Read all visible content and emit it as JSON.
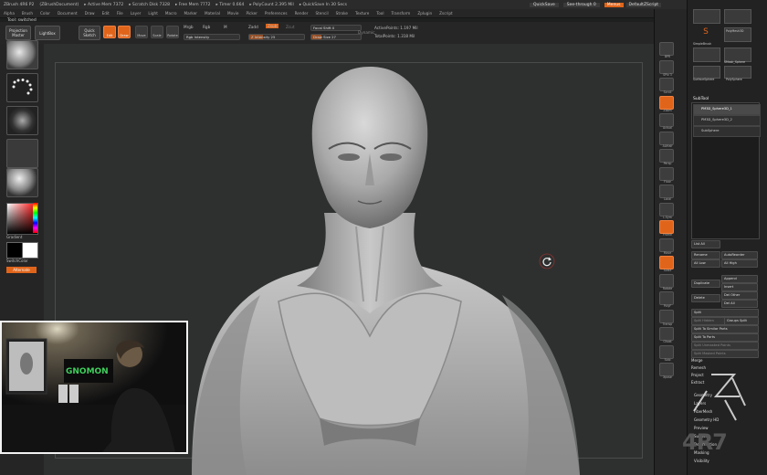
{
  "titlebar": {
    "items": [
      "ZBrush 4R6 P2",
      "(ZBrushDocument)",
      "▸ Active Mem 7372",
      "▸ Scratch Disk 7328",
      "▸ Free Mem 7772",
      "▸ Timer 0.664",
      "▸ PolyCount 2.395 Mil",
      "▸ QuickSave In 30 Secs"
    ],
    "quicksave": "QuickSave",
    "seethrough": "See-through",
    "seethrough_value": "0",
    "menus_btn": "Menus",
    "script": "DefaultZScript"
  },
  "menubar": [
    "Alpha",
    "Brush",
    "Color",
    "Document",
    "Draw",
    "Edit",
    "File",
    "Layer",
    "Light",
    "Macro",
    "Marker",
    "Material",
    "Movie",
    "Picker",
    "Preferences",
    "Render",
    "Stencil",
    "Stroke",
    "Texture",
    "Tool",
    "Transform",
    "Zplugin",
    "Zscript"
  ],
  "tool_title": "Tool: switched",
  "top_shelf": {
    "projection_master": "Projection Master",
    "lightbox": "LightBox",
    "quick_sketch": "Quick Sketch",
    "edit": "Edit",
    "draw": "Draw",
    "move": "Move",
    "scale": "Scale",
    "rotate": "Rotate",
    "mrgb": "Mrgb",
    "rgb": "Rgb",
    "m": "M",
    "rgb_intensity": "Rgb Intensity",
    "zadd": "Zadd",
    "zsub": "Zsub",
    "zcut": "Zcut",
    "z_intensity": "Z Intensity 25",
    "focal_shift": "Focal Shift 0",
    "draw_size": "Draw Size 27",
    "dynamic": "Dynamic",
    "active_points": "ActivePoints: 1.197 Mil",
    "total_points": "TotalPoints: 1.318 Mil"
  },
  "left_shelf": {
    "gradient": "Gradient",
    "switch_color": "SwitchColor",
    "alternate": "Alternate"
  },
  "right_shelf": {
    "labels": [
      "BPR",
      "SPix 3",
      "Scroll",
      "Zoom",
      "Actual",
      "AAHalf",
      "Persp",
      "Floor",
      "Local",
      "L.Sym",
      "Frame",
      "Move",
      "Scale",
      "Rotate",
      "PolyF",
      "Transp",
      "Ghost",
      "Solo",
      "Xpose"
    ]
  },
  "palette": {
    "thumb_labels": [
      "SimpleBrush",
      "PolyMesh3D",
      "ZSphere",
      "SMask_Sphere",
      "Eraser",
      "PolySphere",
      "SurfaceSphere"
    ],
    "subtool_header": "SubTool",
    "subtools": [
      "PM3D_Sphere3D_1",
      "PM3D_Sphere3D_2",
      "SubSphere"
    ],
    "list_all": "List All",
    "rename": "Rename",
    "auto_reorder": "AutoReorder",
    "all_low": "All Low",
    "all_high": "All High",
    "duplicate": "Duplicate",
    "append": "Append",
    "insert": "Insert",
    "delete": "Delete",
    "del_other": "Del Other",
    "del_all": "Del All",
    "split": "Split",
    "split_hidden": "Split Hidden",
    "groups_split": "Groups Split",
    "split_unmasked": "Split To Similar Parts",
    "split_parts": "Split To Parts",
    "split_unmasked_pts": "Split Unmasked Points",
    "split_masked_pts": "Split Masked Points",
    "merge": "Merge",
    "remesh": "Remesh",
    "project": "Project",
    "extract": "Extract",
    "sections": [
      "Geometry",
      "Layers",
      "FiberMesh",
      "Geometry HD",
      "Preview",
      "Surface",
      "Deformation",
      "Masking",
      "Visibility"
    ]
  },
  "watermark": "4R7",
  "video_sign": "GNOMON"
}
